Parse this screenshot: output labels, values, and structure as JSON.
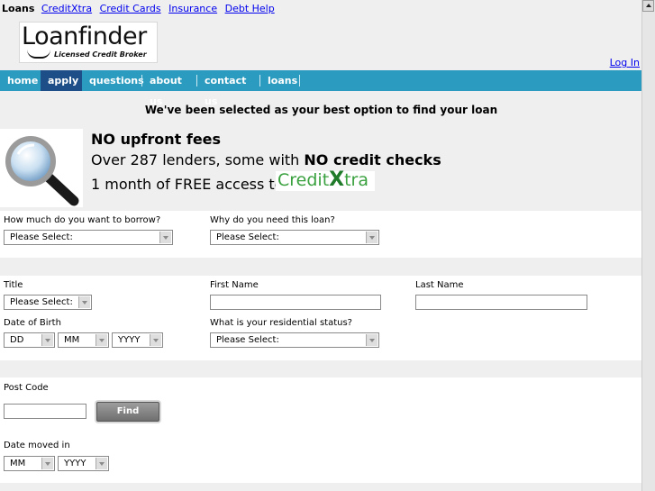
{
  "toplinks": {
    "brand": "Loans",
    "links": [
      "CreditXtra",
      "Credit Cards",
      "Insurance",
      "Debt Help"
    ]
  },
  "logo": {
    "text": "Loanfinder",
    "tagline": "Licensed Credit Broker"
  },
  "login_label": "Log In",
  "nav": [
    "home",
    "apply",
    "questions",
    "about us",
    "contact us",
    "loans"
  ],
  "headline": "We've been selected as your best option to find your loan",
  "promo": {
    "line1": "NO upfront fees",
    "line2_prefix": "Over 287 lenders, some with ",
    "line2_bold": "NO credit checks",
    "line3": "1 month of FREE access to",
    "creditxtra_logo": "CreditXtra"
  },
  "form": {
    "borrow_label": "How much do you want to borrow?",
    "borrow_value": "Please Select:",
    "reason_label": "Why do you need this loan?",
    "reason_value": "Please Select:",
    "title_label": "Title",
    "title_value": "Please Select:",
    "first_name_label": "First Name",
    "last_name_label": "Last Name",
    "dob_label": "Date of Birth",
    "dob_day": "DD",
    "dob_month": "MM",
    "dob_year": "YYYY",
    "residential_label": "What is your residential status?",
    "residential_value": "Please Select:",
    "postcode_label": "Post Code",
    "find_address_label": "Find Address",
    "moved_label": "Date moved in",
    "moved_month": "MM",
    "moved_year": "YYYY"
  },
  "colors": {
    "nav_bg": "#2b9bbf",
    "nav_active": "#1d4e88",
    "link": "#0000ee",
    "creditxtra_green": "#3aa13f"
  }
}
